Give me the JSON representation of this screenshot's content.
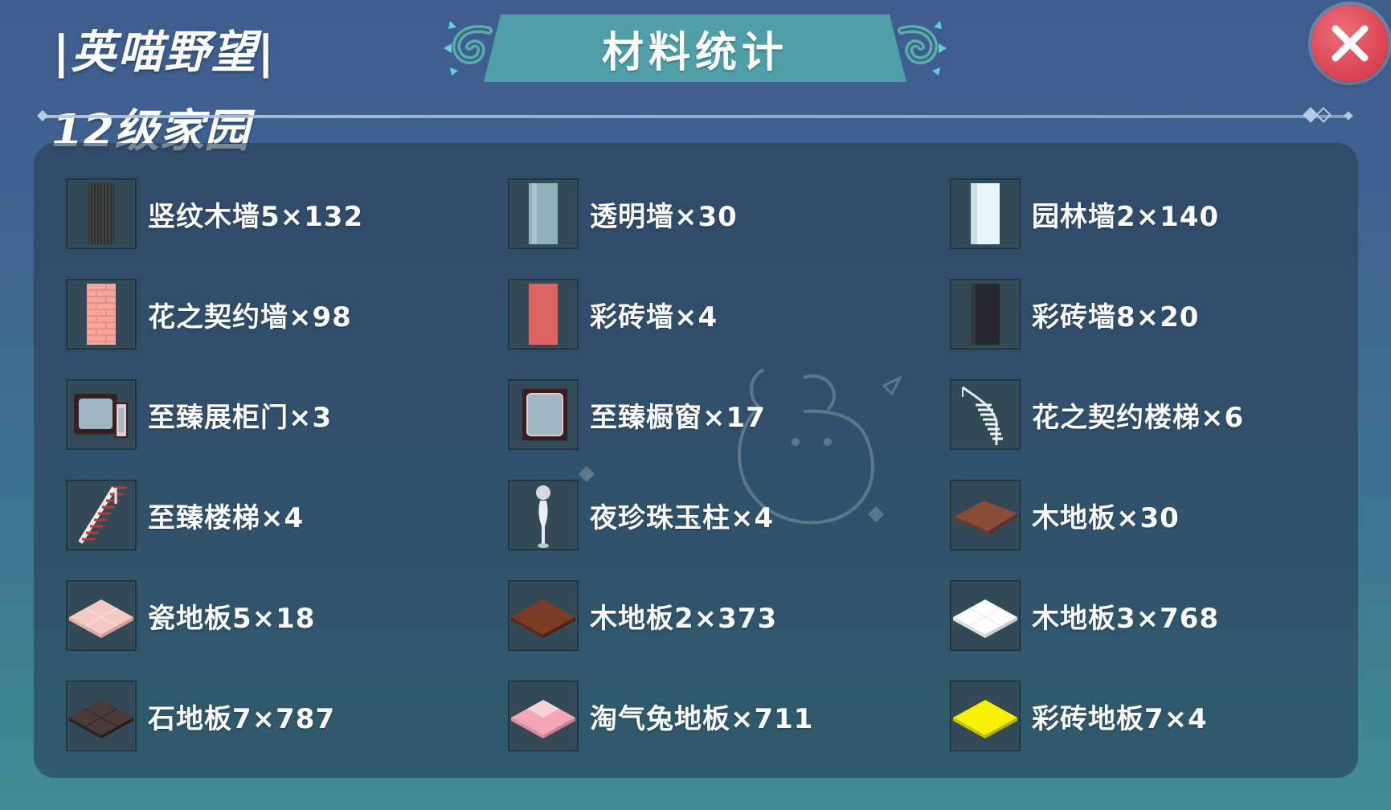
{
  "header": {
    "title": "|英喵野望|",
    "subtitle": "12级家园",
    "banner": "材料统计"
  },
  "colors": {
    "banner": "#4f9fa8",
    "close_button": "#d94150",
    "panel": "#283e54"
  },
  "items": [
    {
      "label": "竖纹木墙5×132",
      "icon": "striped-wood-wall-icon"
    },
    {
      "label": "透明墙×30",
      "icon": "transparent-wall-icon"
    },
    {
      "label": "园林墙2×140",
      "icon": "garden-wall-icon"
    },
    {
      "label": "花之契约墙×98",
      "icon": "pink-brick-wall-icon"
    },
    {
      "label": "彩砖墙×4",
      "icon": "red-tile-wall-icon"
    },
    {
      "label": "彩砖墙8×20",
      "icon": "dark-tile-wall-icon"
    },
    {
      "label": "至臻展柜门×3",
      "icon": "display-cabinet-door-icon"
    },
    {
      "label": "至臻橱窗×17",
      "icon": "display-window-icon"
    },
    {
      "label": "花之契约楼梯×6",
      "icon": "spiral-stairs-icon"
    },
    {
      "label": "至臻楼梯×4",
      "icon": "stairs-icon"
    },
    {
      "label": "夜珍珠玉柱×4",
      "icon": "pearl-pillar-icon"
    },
    {
      "label": "木地板×30",
      "icon": "wood-floor-icon"
    },
    {
      "label": "瓷地板5×18",
      "icon": "porcelain-floor-icon"
    },
    {
      "label": "木地板2×373",
      "icon": "dark-wood-floor-icon"
    },
    {
      "label": "木地板3×768",
      "icon": "white-floor-icon"
    },
    {
      "label": "石地板7×787",
      "icon": "stone-floor-icon"
    },
    {
      "label": "淘气兔地板×711",
      "icon": "bunny-floor-icon"
    },
    {
      "label": "彩砖地板7×4",
      "icon": "yellow-tile-floor-icon"
    }
  ]
}
